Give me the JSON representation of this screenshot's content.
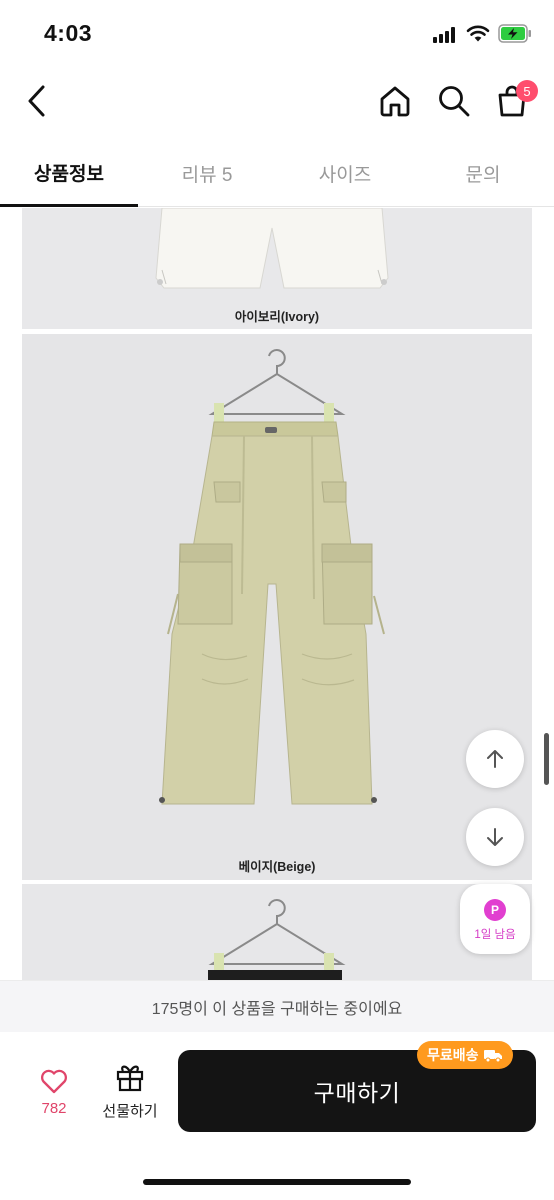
{
  "status_bar": {
    "time": "4:03"
  },
  "nav": {
    "cart_count": "5"
  },
  "tabs": [
    {
      "label": "상품정보",
      "active": true
    },
    {
      "label": "리뷰 5",
      "active": false
    },
    {
      "label": "사이즈",
      "active": false
    },
    {
      "label": "문의",
      "active": false
    }
  ],
  "photos": {
    "ivory_caption": "아이보리(Ivory)",
    "beige_caption": "베이지(Beige)"
  },
  "point_badge": {
    "symbol": "P",
    "label": "1일 남음",
    "color": "#e13fd0"
  },
  "buyers_banner": "175명이 이 상품을 구매하는 중이에요",
  "bottom_bar": {
    "like_count": "782",
    "gift_label": "선물하기",
    "buy_label": "구매하기",
    "free_shipping_label": "무료배송"
  },
  "colors": {
    "accent_pink": "#ff4d6d",
    "like": "#e0456a",
    "shipping": "#ff9a1e",
    "buy_button": "#141414"
  }
}
